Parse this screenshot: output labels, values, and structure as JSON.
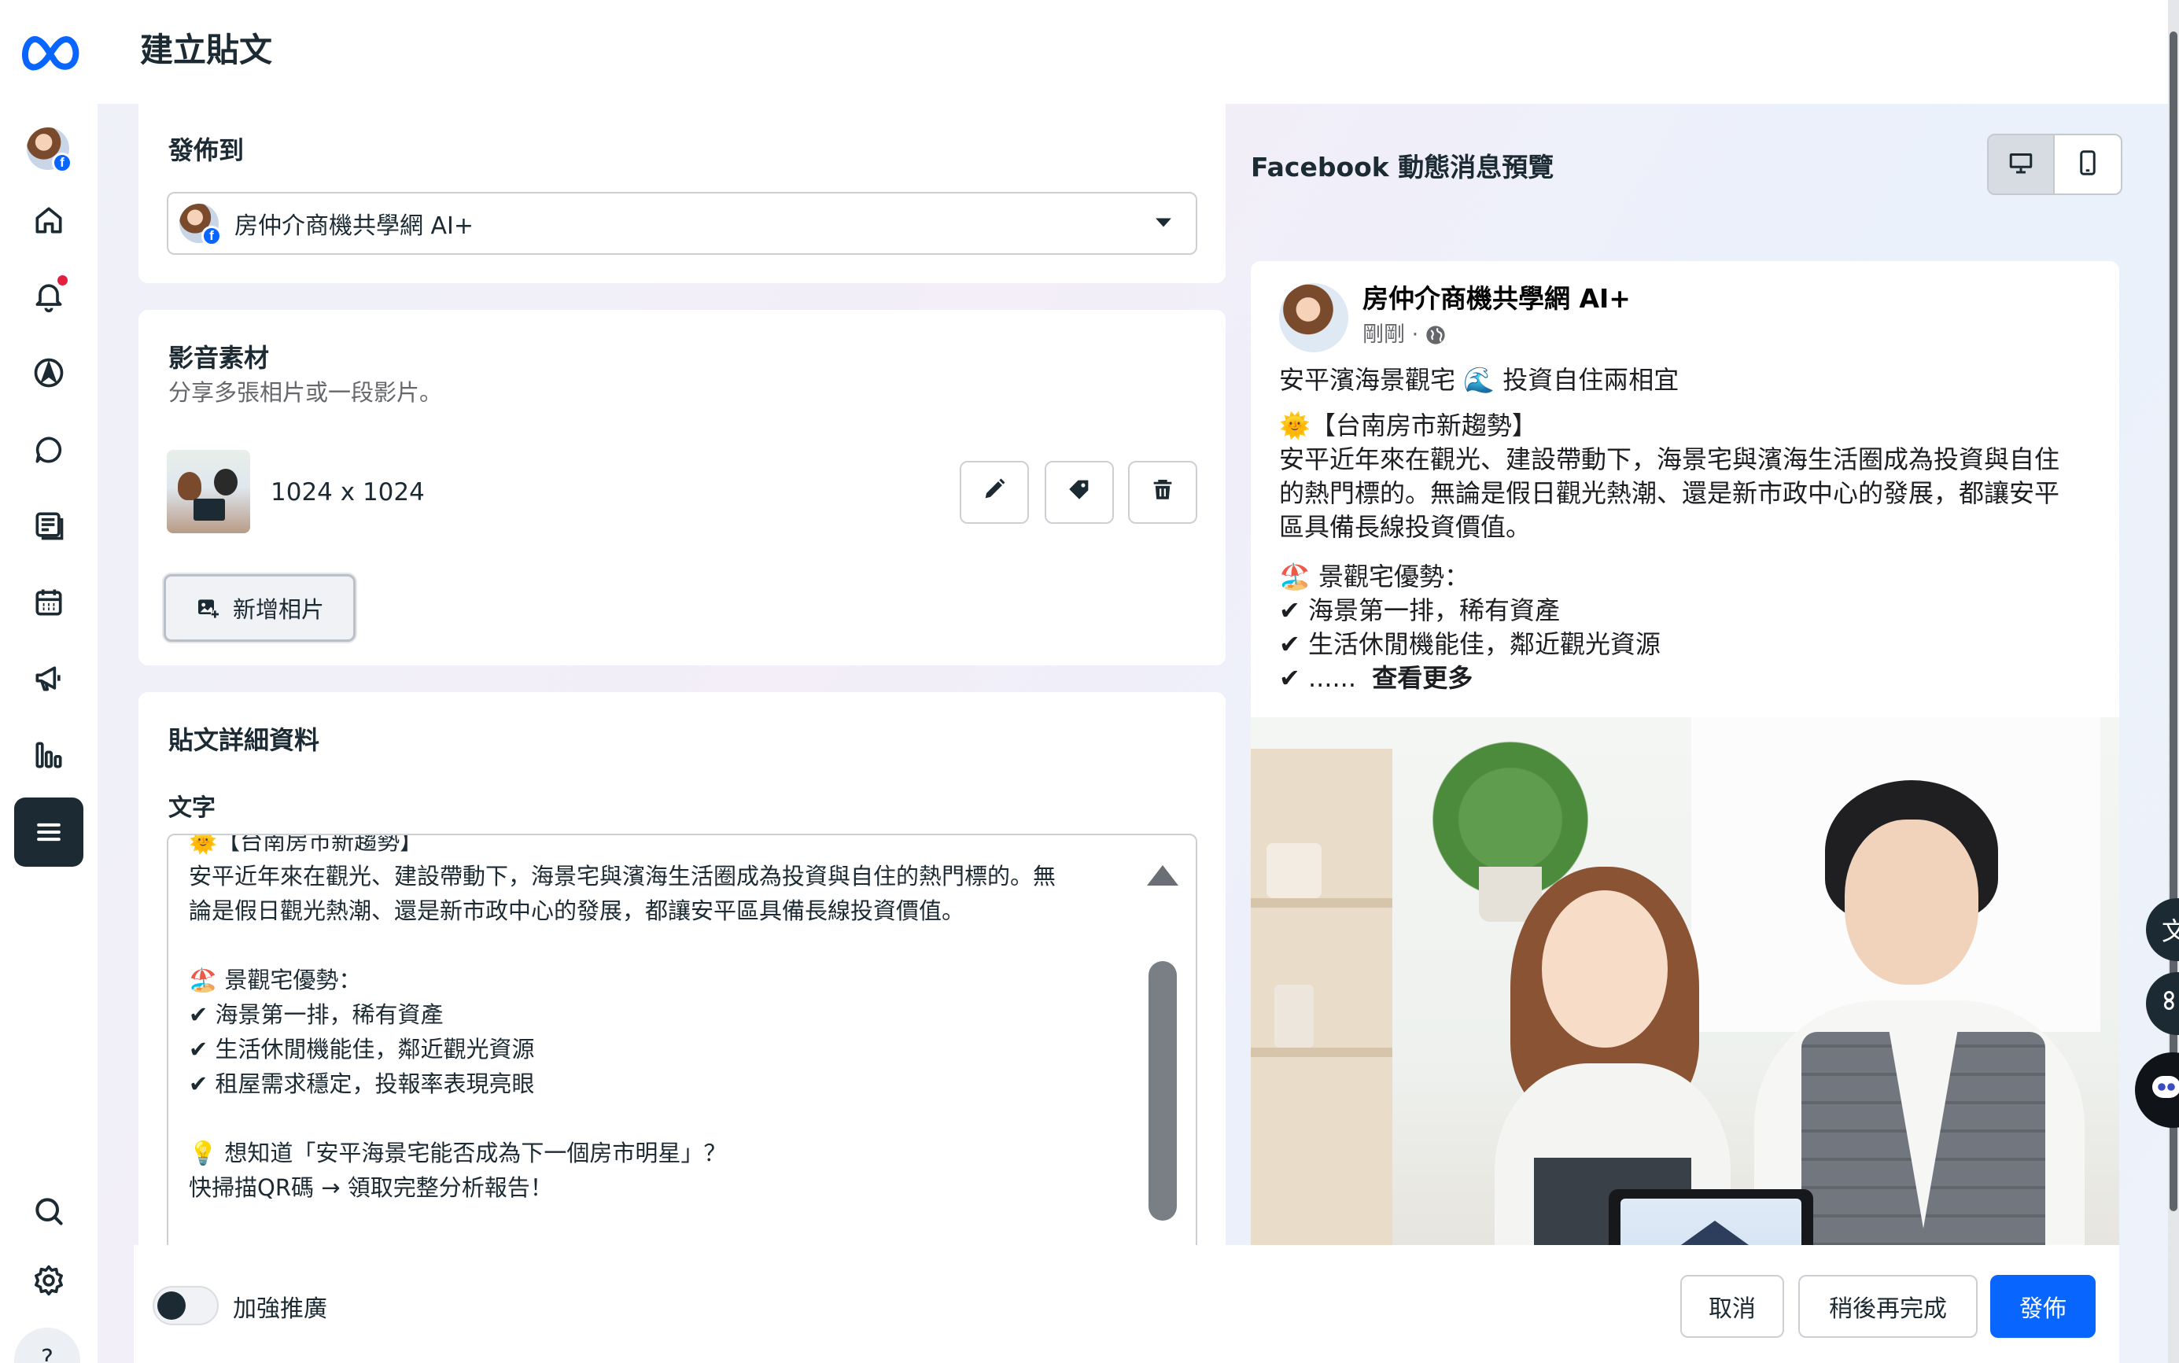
{
  "app": {
    "brand": "meta-logo"
  },
  "header": {
    "title": "建立貼文"
  },
  "sidebar": {
    "items": [
      {
        "name": "profile-avatar"
      },
      {
        "name": "home-icon"
      },
      {
        "name": "bell-icon"
      },
      {
        "name": "compass-icon"
      },
      {
        "name": "chat-icon"
      },
      {
        "name": "content-icon"
      },
      {
        "name": "calendar-icon"
      },
      {
        "name": "megaphone-icon"
      },
      {
        "name": "insights-icon"
      },
      {
        "name": "menu-icon"
      }
    ],
    "bottom": [
      {
        "name": "search-icon"
      },
      {
        "name": "gear-icon"
      },
      {
        "name": "help-icon",
        "label": "?"
      }
    ]
  },
  "publish_to": {
    "title": "發佈到",
    "selected_page": "房仲介商機共學網 AI+"
  },
  "media": {
    "title": "影音素材",
    "subtitle": "分享多張相片或一段影片。",
    "image_size": "1024 x 1024",
    "add_photo_label": "新增相片"
  },
  "details": {
    "title": "貼文詳細資料",
    "text_label": "文字",
    "text_value": "🌞【台南房市新趨勢】\n安平近年來在觀光、建設帶動下，海景宅與濱海生活圈成為投資與自住的熱門標的。無\n論是假日觀光熱潮、還是新市政中心的發展，都讓安平區具備長線投資價值。\n\n🏖️ 景觀宅優勢：\n✔ 海景第一排，稀有資產\n✔ 生活休閒機能佳，鄰近觀光資源\n✔ 租屋需求穩定，投報率表現亮眼\n\n💡 想知道「安平海景宅能否成為下一個房市明星」？\n快掃描QR碼 → 領取完整分析報告！"
  },
  "preview": {
    "title": "Facebook 動態消息預覽",
    "page_name": "房仲介商機共學網 AI+",
    "time": "剛剛 ·",
    "lines": [
      "安平濱海景觀宅 🌊 投資自住兩相宜",
      "🌞【台南房市新趨勢】",
      "安平近年來在觀光、建設帶動下，海景宅與濱海生活圈成為投資與自住",
      "的熱門標的。無論是假日觀光熱潮、還是新市政中心的發展，都讓安平",
      "區具備長線投資價值。",
      "🏖️ 景觀宅優勢：",
      "✔ 海景第一排，稀有資產",
      "✔ 生活休閒機能佳，鄰近觀光資源"
    ],
    "last_line_prefix": "✔ ......",
    "see_more": "查看更多"
  },
  "footer": {
    "boost_label": "加強推廣",
    "cancel_label": "取消",
    "later_label": "稍後再完成",
    "publish_label": "發佈"
  },
  "floaters": {
    "translate_label": "文"
  },
  "colors": {
    "accent": "#0866ff",
    "active_nav": "#1c2b33",
    "notification": "#e41e3f"
  }
}
